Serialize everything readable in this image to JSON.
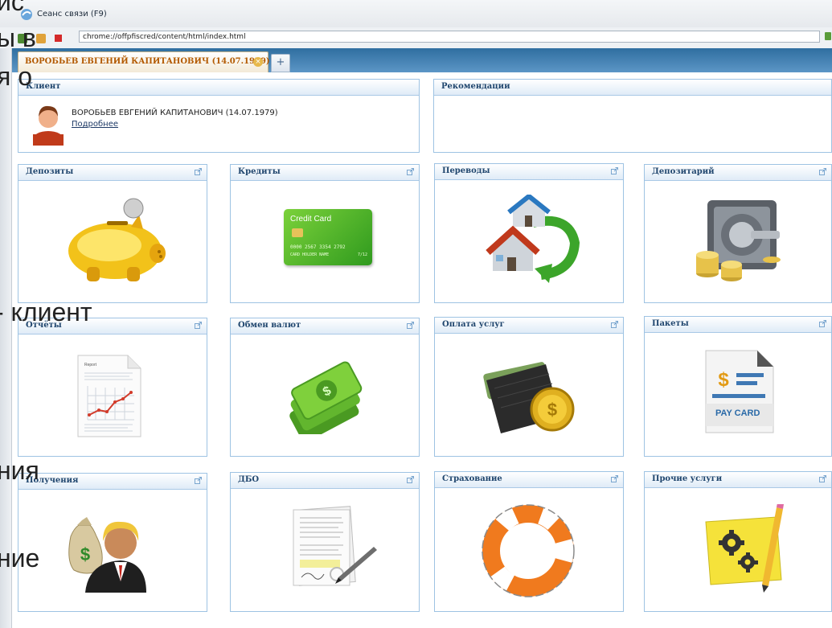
{
  "window": {
    "title": "Сеанс связи (F9)",
    "url": "chrome://offpfiscred/content/html/index.html"
  },
  "tabs": [
    {
      "label": "ВОРОБЬЕВ ЕВГЕНИЙ КАПИТАНОВИЧ  (14.07.1979)",
      "close_symbol": "×"
    }
  ],
  "new_tab_symbol": "+",
  "client_panel": {
    "title": "Клиент",
    "name": "ВОРОБЬЕВ ЕВГЕНИЙ КАПИТАНОВИЧ (14.07.1979)",
    "more_link": "Подробнее"
  },
  "recommendations_panel": {
    "title": "Рекомендации"
  },
  "services": [
    {
      "title": "Депозиты",
      "icon": "piggy-bank-icon"
    },
    {
      "title": "Кредиты",
      "icon": "credit-card-icon",
      "card_text": "Credit Card",
      "card_number": "0000 2567 3354 2792",
      "card_holder": "CARD HOLDER NAME",
      "card_expiry": "7/12"
    },
    {
      "title": "Переводы",
      "icon": "transfer-houses-icon"
    },
    {
      "title": "Депозитарий",
      "icon": "safe-coins-icon"
    },
    {
      "title": "Отчёты",
      "icon": "report-document-icon",
      "doc_title": "Report"
    },
    {
      "title": "Обмен валют",
      "icon": "money-bills-icon"
    },
    {
      "title": "Оплата услуг",
      "icon": "wallet-coin-icon"
    },
    {
      "title": "Пакеты",
      "icon": "paycard-icon",
      "doc_text": "PAY CARD"
    },
    {
      "title": "Получения",
      "icon": "money-bag-man-icon"
    },
    {
      "title": "ДБО",
      "icon": "signed-contract-icon"
    },
    {
      "title": "Страхование",
      "icon": "life-buoy-icon"
    },
    {
      "title": "Прочие услуги",
      "icon": "gears-pencil-icon"
    }
  ],
  "overlay_text": [
    "ы в",
    "я о",
    "- клиент",
    "ния",
    "ние",
    "ис"
  ]
}
